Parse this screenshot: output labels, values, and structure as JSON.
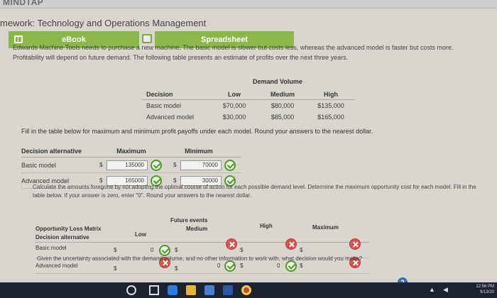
{
  "brand": "MINDTAP",
  "course_title": "mework: Technology and Operations Management",
  "tabs": [
    {
      "label": "eBook"
    },
    {
      "label": "Spreadsheet"
    }
  ],
  "intro_text": "Edwards Machine Tools needs to purchase a new machine. The basic model is slower but costs less, whereas the advanced model is faster but costs more. Profitability will depend on future demand. The following table presents an estimate of profits over the next three years.",
  "payoff_table": {
    "group_header": "Demand Volume",
    "headers": [
      "Decision",
      "Low",
      "Medium",
      "High"
    ],
    "rows": [
      {
        "decision": "Basic model",
        "low": "$70,000",
        "medium": "$80,000",
        "high": "$135,000"
      },
      {
        "decision": "Advanced model",
        "low": "$30,000",
        "medium": "$85,000",
        "high": "$165,000"
      }
    ]
  },
  "fill_instruction": "Fill in the table below for maximum and minimum profit payoffs under each model. Round your answers to the nearest dollar.",
  "maxmin_table": {
    "headers": [
      "Decision alternative",
      "Maximum",
      "Minimum"
    ],
    "currency": "$",
    "rows": [
      {
        "label": "Basic model",
        "max": "135000",
        "min": "70000"
      },
      {
        "label": "Advanced model",
        "max": "165000",
        "min": "30000"
      }
    ]
  },
  "calc_instruction": "Calculate the amounts foregone by not adopting the optimal course of action for each possible demand level. Determine the maximum opportunity cost for each model. Fill in the table below. If your answer is zero, enter \"0\". Round your answers to the nearest dollar.",
  "opp_table": {
    "title": "Opportunity Loss Matrix",
    "group_header": "Future events",
    "headers": [
      "Decision alternative",
      "Low",
      "Medium",
      "High",
      "Maximum"
    ],
    "currency": "$",
    "rows": [
      {
        "label": "Basic model",
        "low": "0",
        "medium": "",
        "high": "",
        "max": ""
      },
      {
        "label": "Advanced model",
        "low": "",
        "medium": "0",
        "high": "0",
        "max": ""
      }
    ]
  },
  "uncertainty_text": "Given the uncertainty associated with the demand volume, and no other information to work with, what decision would you make?",
  "taskbar": {
    "time": "12:56 PM",
    "date": "9/13/20",
    "help": "?"
  },
  "colors": {
    "tab_green": "#8ab94a",
    "check_green": "#4e9a29",
    "error_red": "#d9534f"
  }
}
